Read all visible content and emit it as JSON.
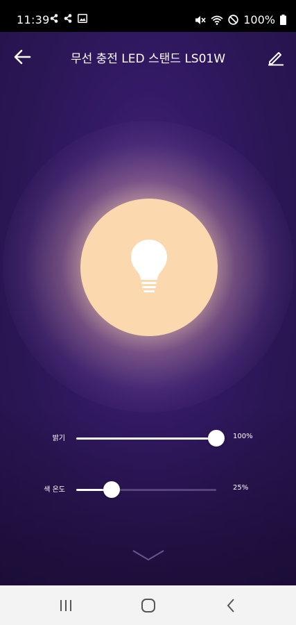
{
  "status_bar": {
    "time": "11:39",
    "battery": "100%",
    "left_icons": [
      "share-icon",
      "share-icon",
      "image-icon"
    ],
    "right_icons": [
      "mute-icon",
      "wifi-icon",
      "dnd-icon",
      "battery-icon"
    ]
  },
  "header": {
    "title": "무선 충전 LED 스탠드 LS01W",
    "back_icon": "arrow-left-icon",
    "edit_icon": "pencil-icon"
  },
  "lamp": {
    "icon": "lightbulb-icon",
    "color": "#fcd8ae"
  },
  "sliders": [
    {
      "label": "밝기",
      "value_text": "100%",
      "value": 1.0
    },
    {
      "label": "색 온도",
      "value_text": "25%",
      "value": 0.25
    }
  ],
  "expand": {
    "icon": "chevron-down-icon"
  },
  "nav_bar": {
    "recents_icon": "recents-icon",
    "home_icon": "home-icon",
    "back_icon": "back-chevron-icon"
  }
}
